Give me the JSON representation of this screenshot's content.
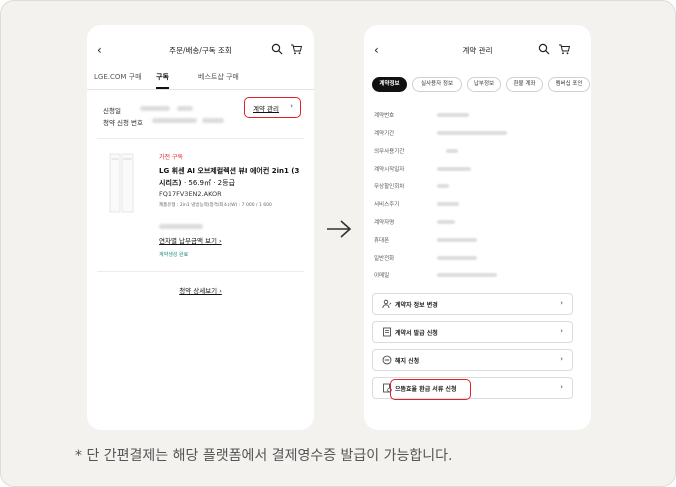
{
  "left": {
    "title": "주문/배송/구독 조회",
    "tabs": [
      "LGE.COM 구매",
      "구독",
      "베스트샵 구매"
    ],
    "apply_date_label": "신청일",
    "apply_no_label": "청약 신청 번호",
    "manage_button": "계약 관리",
    "product": {
      "tag": "가전 구독",
      "name": "LG 휘센 AI 오브제컬렉션 뷰I 에어컨 2in1 (3시리즈)",
      "spec_inline": "· 56.9㎡ · 2등급",
      "model": "FQ17FV3EN2.AKOR",
      "spec_detail": "제품유형 : 2in1   냉방능력(정격/최소)(W) : 7    000 / 1 600",
      "monthly_link": "연차별 납부금액 보기",
      "status": "계약생성 완료"
    },
    "detail_link": "청약 상세보기"
  },
  "right": {
    "title": "계약 관리",
    "chips": [
      "계약정보",
      "실사용자 정보",
      "납부정보",
      "환불 계좌",
      "멤버십 포인"
    ],
    "info_labels": [
      "계약번호",
      "계약기간",
      "의무사용기간",
      "계약시작일자",
      "무상할인회차",
      "서비스주기",
      "계약자명",
      "휴대폰",
      "일반전화",
      "이메일"
    ],
    "actions": [
      {
        "label": "계약자 정보 변경",
        "icon": "user-edit-icon"
      },
      {
        "label": "계약서 발급 신청",
        "icon": "document-icon"
      },
      {
        "label": "해지 신청",
        "icon": "cancel-circle-icon"
      },
      {
        "label": "으뜸효율 환급 서류 신청",
        "icon": "receipt-icon"
      }
    ]
  },
  "footnote": "* 단 간편결제는 해당 플랫폼에서 결제영수증 발급이 가능합니다.",
  "colors": {
    "accent": "#e0202c",
    "status": "#1e8c7e",
    "background": "#f3f2ef"
  }
}
